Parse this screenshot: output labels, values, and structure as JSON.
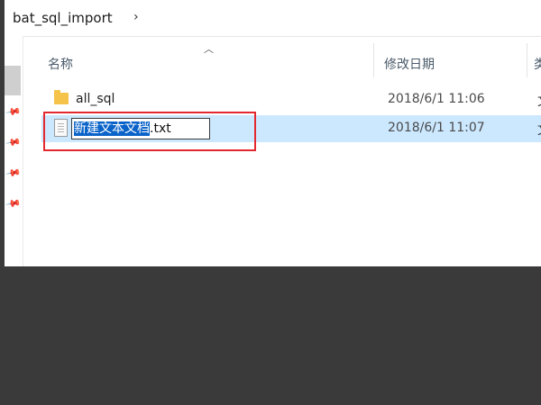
{
  "address_bar": {
    "path": "bat_sql_import",
    "chevron": "›"
  },
  "navigation": {
    "pin_icon": "pin-icon"
  },
  "column_headers": {
    "name": "名称",
    "date_modified": "修改日期",
    "cut_off": "类"
  },
  "files": [
    {
      "name": "all_sql",
      "date_modified": "2018/6/1 11:06",
      "type_icon": "folder-icon",
      "trailing_cutoff": "文"
    },
    {
      "name_selected_part": "新建文本文档",
      "name_extension": ".txt",
      "date_modified": "2018/6/1 11:07",
      "type_icon": "text-file-icon",
      "trailing_cutoff": "文",
      "renaming": true
    }
  ],
  "colors": {
    "selected_row": "#cce8ff",
    "rename_highlight": "#0a63c9",
    "annotation_frame": "#e4282f",
    "folder": "#f5c34a",
    "background_dark": "#3a3a3a"
  }
}
